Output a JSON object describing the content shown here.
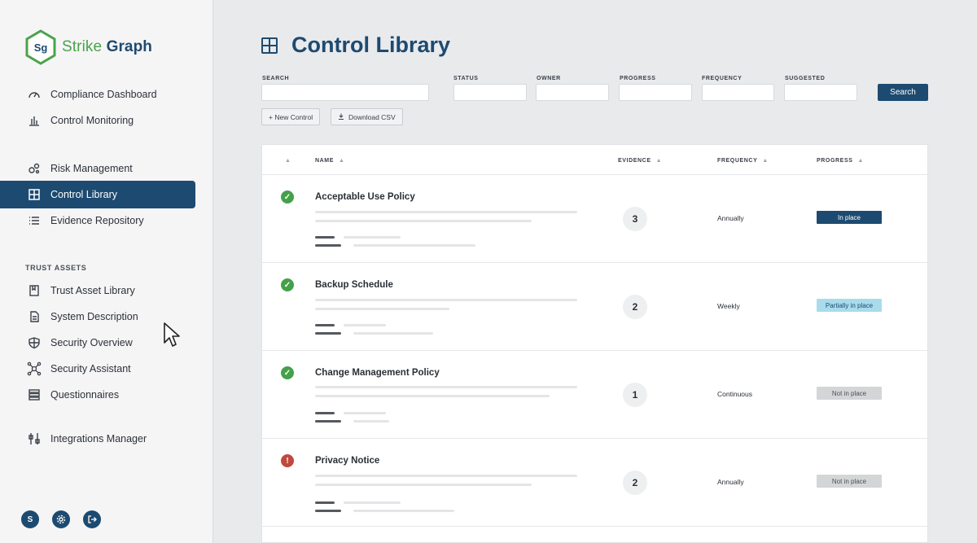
{
  "brand": {
    "mark": "Sg",
    "name_part1": "Strike",
    "name_part2": "Graph",
    "color_primary": "#1d4a70",
    "color_green": "#4aa34a"
  },
  "sidebar": {
    "items_top": [
      {
        "label": "Compliance Dashboard",
        "icon": "gauge-icon"
      },
      {
        "label": "Control Monitoring",
        "icon": "bar-chart-icon"
      }
    ],
    "items_mid": [
      {
        "label": "Risk Management",
        "icon": "risk-circles-icon"
      },
      {
        "label": "Control Library",
        "icon": "grid-icon",
        "active": true
      },
      {
        "label": "Evidence Repository",
        "icon": "list-icon"
      }
    ],
    "section_label": "TRUST ASSETS",
    "items_trust": [
      {
        "label": "Trust Asset Library",
        "icon": "book-icon"
      },
      {
        "label": "System Description",
        "icon": "document-icon"
      },
      {
        "label": "Security Overview",
        "icon": "shield-icon"
      },
      {
        "label": "Security Assistant",
        "icon": "network-icon"
      },
      {
        "label": "Questionnaires",
        "icon": "stack-icon"
      }
    ],
    "items_bottom": [
      {
        "label": "Integrations Manager",
        "icon": "sliders-icon"
      }
    ],
    "footer": {
      "user_initial": "S",
      "settings_icon": "gear-icon",
      "logout_icon": "logout-icon"
    }
  },
  "page": {
    "title": "Control Library",
    "icon": "grid-icon"
  },
  "filters": {
    "search_label": "SEARCH",
    "status_label": "STATUS",
    "owner_label": "OWNER",
    "progress_label": "PROGRESS",
    "frequency_label": "FREQUENCY",
    "suggested_label": "SUGGESTED",
    "search_button": "Search"
  },
  "toolbar": {
    "new_control": "+ New Control",
    "download_csv": "Download CSV"
  },
  "table": {
    "columns": {
      "sort": "▲",
      "name": "NAME",
      "evidence": "EVIDENCE",
      "frequency": "FREQUENCY",
      "progress": "PROGRESS"
    },
    "rows": [
      {
        "status": "ok",
        "name": "Acceptable Use Policy",
        "evidence": "3",
        "frequency": "Annually",
        "progress": "In place"
      },
      {
        "status": "ok",
        "name": "Backup Schedule",
        "evidence": "2",
        "frequency": "Weekly",
        "progress": "Partially in place"
      },
      {
        "status": "ok",
        "name": "Change Management Policy",
        "evidence": "1",
        "frequency": "Continuous",
        "progress": "Not in place"
      },
      {
        "status": "warn",
        "name": "Privacy Notice",
        "evidence": "2",
        "frequency": "Annually",
        "progress": "Not in place"
      }
    ]
  }
}
